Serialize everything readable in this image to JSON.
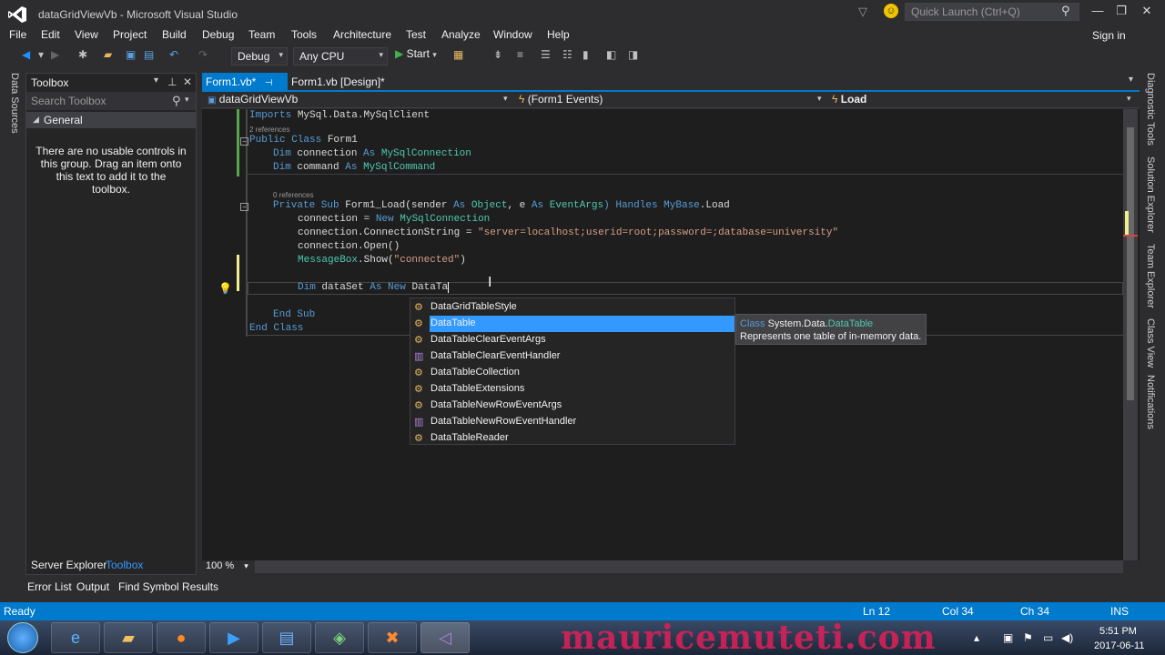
{
  "window": {
    "title": "dataGridViewVb - Microsoft Visual Studio",
    "quick_launch_placeholder": "Quick Launch (Ctrl+Q)",
    "sign_in": "Sign in"
  },
  "menu": [
    "File",
    "Edit",
    "View",
    "Project",
    "Build",
    "Debug",
    "Team",
    "Tools",
    "Architecture",
    "Test",
    "Analyze",
    "Window",
    "Help"
  ],
  "toolbar": {
    "configuration": "Debug",
    "platform": "Any CPU",
    "start_label": "Start"
  },
  "left_strip": {
    "data_sources": "Data Sources"
  },
  "toolbox": {
    "title": "Toolbox",
    "search_placeholder": "Search Toolbox",
    "group": "General",
    "empty_message": "There are no usable controls in this group. Drag an item onto this text to add it to the toolbox.",
    "bottom_tabs": [
      "Server Explorer",
      "Toolbox"
    ]
  },
  "doc_tabs": {
    "active": "Form1.vb*",
    "other": "Form1.vb [Design]*"
  },
  "nav": {
    "project": "dataGridViewVb",
    "object": "(Form1 Events)",
    "member": "Load"
  },
  "code": {
    "line_imports_kw": "Imports",
    "line_imports_ns": "MySql.Data.MySqlClient",
    "lens_class": "2 references",
    "class_kw": "Public Class",
    "class_name": "Form1",
    "dim_kw": "Dim",
    "connection_var": "connection",
    "as_kw": "As",
    "connection_type": "MySqlConnection",
    "command_var": "command",
    "command_type": "MySqlCommand",
    "lens_sub": "0 references",
    "sub_sig_kw": "Private Sub",
    "sub_name": "Form1_Load(sender",
    "object_type": "Object",
    "e_param": ", e",
    "eventargs_type": "EventArgs",
    "handles_part": ") Handles",
    "mybase": "MyBase",
    "load_part": ".Load",
    "conn_assign": "connection = ",
    "new_kw": "New",
    "conn_string_prefix": "connection.ConnectionString = ",
    "conn_string": "\"server=localhost;userid=root;password=;database=university\"",
    "conn_open": "connection.Open()",
    "messagebox": "MessageBox",
    "msg_show": ".Show(",
    "msg_arg": "\"connected\"",
    "msg_close": ")",
    "dataset_var": " dataSet ",
    "typed_text": "DataTa",
    "end_sub": "End Sub",
    "end_class": "End Class"
  },
  "completion": {
    "items": [
      {
        "label": "DataGridTableStyle",
        "kind": "class"
      },
      {
        "label": "DataTable",
        "kind": "class"
      },
      {
        "label": "DataTableClearEventArgs",
        "kind": "class"
      },
      {
        "label": "DataTableClearEventHandler",
        "kind": "delegate"
      },
      {
        "label": "DataTableCollection",
        "kind": "class"
      },
      {
        "label": "DataTableExtensions",
        "kind": "class"
      },
      {
        "label": "DataTableNewRowEventArgs",
        "kind": "class"
      },
      {
        "label": "DataTableNewRowEventHandler",
        "kind": "delegate"
      },
      {
        "label": "DataTableReader",
        "kind": "class"
      }
    ],
    "selected_index": 1,
    "tooltip_kind": "Class",
    "tooltip_ns": "System.Data.",
    "tooltip_type": "DataTable",
    "tooltip_desc": "Represents one table of in-memory data."
  },
  "editor": {
    "zoom": "100 %"
  },
  "right_strip": [
    "Diagnostic Tools",
    "Solution Explorer",
    "Team Explorer",
    "Class View",
    "Notifications"
  ],
  "bottom_tabs": [
    "Error List",
    "Output",
    "Find Symbol Results"
  ],
  "status": {
    "state": "Ready",
    "line": "Ln 12",
    "col": "Col 34",
    "ch": "Ch 34",
    "mode": "INS"
  },
  "taskbar": {
    "watermark": "mauricemuteti.com",
    "time": "5:51 PM",
    "date": "2017-06-11"
  },
  "colors": {
    "accent": "#007acc",
    "selection": "#3399ff",
    "keyword": "#569cd6",
    "type": "#4ec9b0",
    "string": "#d69d85"
  }
}
